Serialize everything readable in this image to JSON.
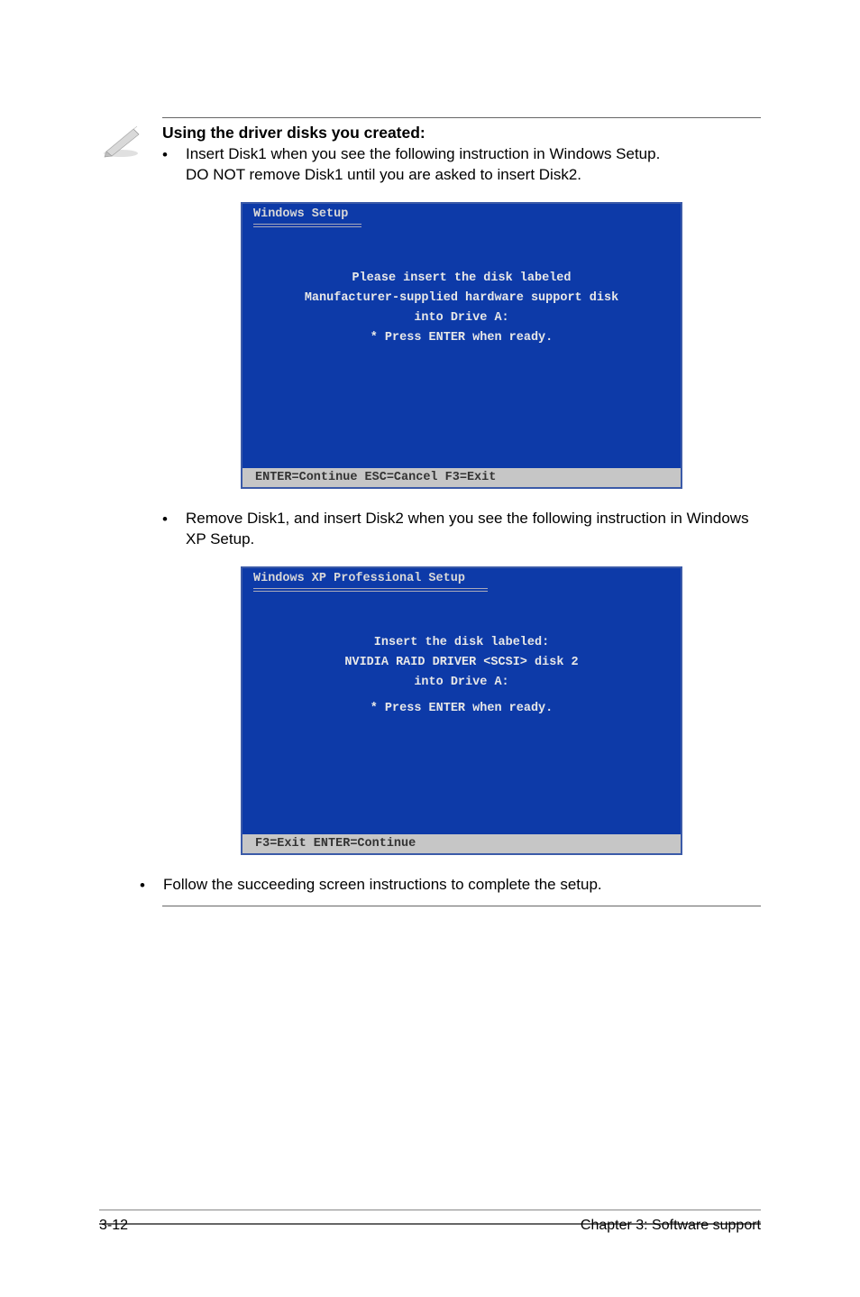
{
  "note": {
    "heading": "Using the driver disks you created:",
    "bullet1_line1": "Insert Disk1 when you see the following instruction in Windows Setup.",
    "bullet1_line2": "DO NOT remove Disk1 until you are asked to insert Disk2.",
    "bullet2": "Remove Disk1, and insert Disk2 when you see the following instruction in Windows XP Setup.",
    "bullet3": "Follow the succeeding screen instructions to complete the setup."
  },
  "screen1": {
    "title": "Windows Setup",
    "line1": "Please insert the disk labeled",
    "line2": "Manufacturer-supplied hardware support disk",
    "line3": "into Drive A:",
    "line4": "*  Press ENTER when ready.",
    "status": "  ENTER=Continue   ESC=Cancel   F3=Exit"
  },
  "screen2": {
    "title": "Windows XP Professional Setup",
    "line1": "Insert the disk labeled:",
    "line2": "NVIDIA RAID DRIVER <SCSI> disk 2",
    "line3": "into Drive A:",
    "line4": "*  Press ENTER when ready.",
    "status": "  F3=Exit   ENTER=Continue"
  },
  "footer": {
    "left": "3-12",
    "right": "Chapter 3: Software support"
  }
}
